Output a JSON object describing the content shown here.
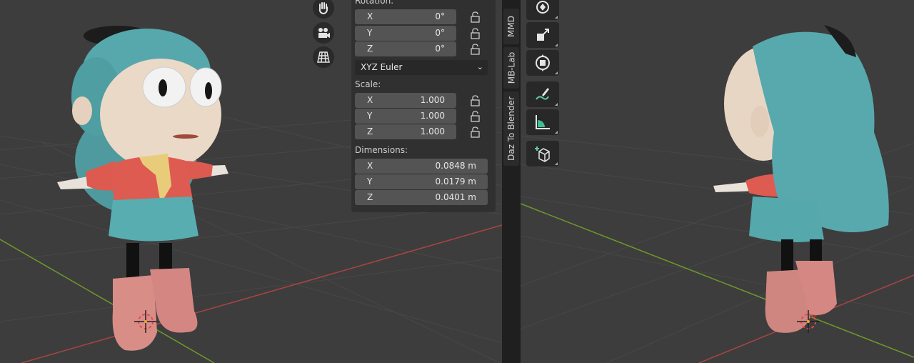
{
  "transform": {
    "rotation": {
      "label": "Rotation:",
      "x": {
        "axis": "X",
        "value": "0°"
      },
      "y": {
        "axis": "Y",
        "value": "0°"
      },
      "z": {
        "axis": "Z",
        "value": "0°"
      }
    },
    "rotation_mode": {
      "value": "XYZ Euler"
    },
    "scale": {
      "label": "Scale:",
      "x": {
        "axis": "X",
        "value": "1.000"
      },
      "y": {
        "axis": "Y",
        "value": "1.000"
      },
      "z": {
        "axis": "Z",
        "value": "1.000"
      }
    },
    "dimensions": {
      "label": "Dimensions:",
      "x": {
        "axis": "X",
        "value": "0.0848 m"
      },
      "y": {
        "axis": "Y",
        "value": "0.0179 m"
      },
      "z": {
        "axis": "Z",
        "value": "0.0401 m"
      }
    }
  },
  "sidebar_tabs": [
    "MMD",
    "MB-Lab",
    "Daz To Blender"
  ],
  "navigation_gizmos": [
    "hand-pan-icon",
    "camera-icon",
    "grid-view-icon"
  ],
  "toolbar_tools": [
    "rotate-icon",
    "scale-icon",
    "transform-icon",
    "annotate-icon",
    "measure-icon",
    "add-cube-icon"
  ],
  "colors": {
    "viewport_bg": "#3d3d3d",
    "panel_bg": "#303030",
    "field_bg": "#545454",
    "x_axis": "#c44545",
    "y_axis": "#7da82b"
  }
}
